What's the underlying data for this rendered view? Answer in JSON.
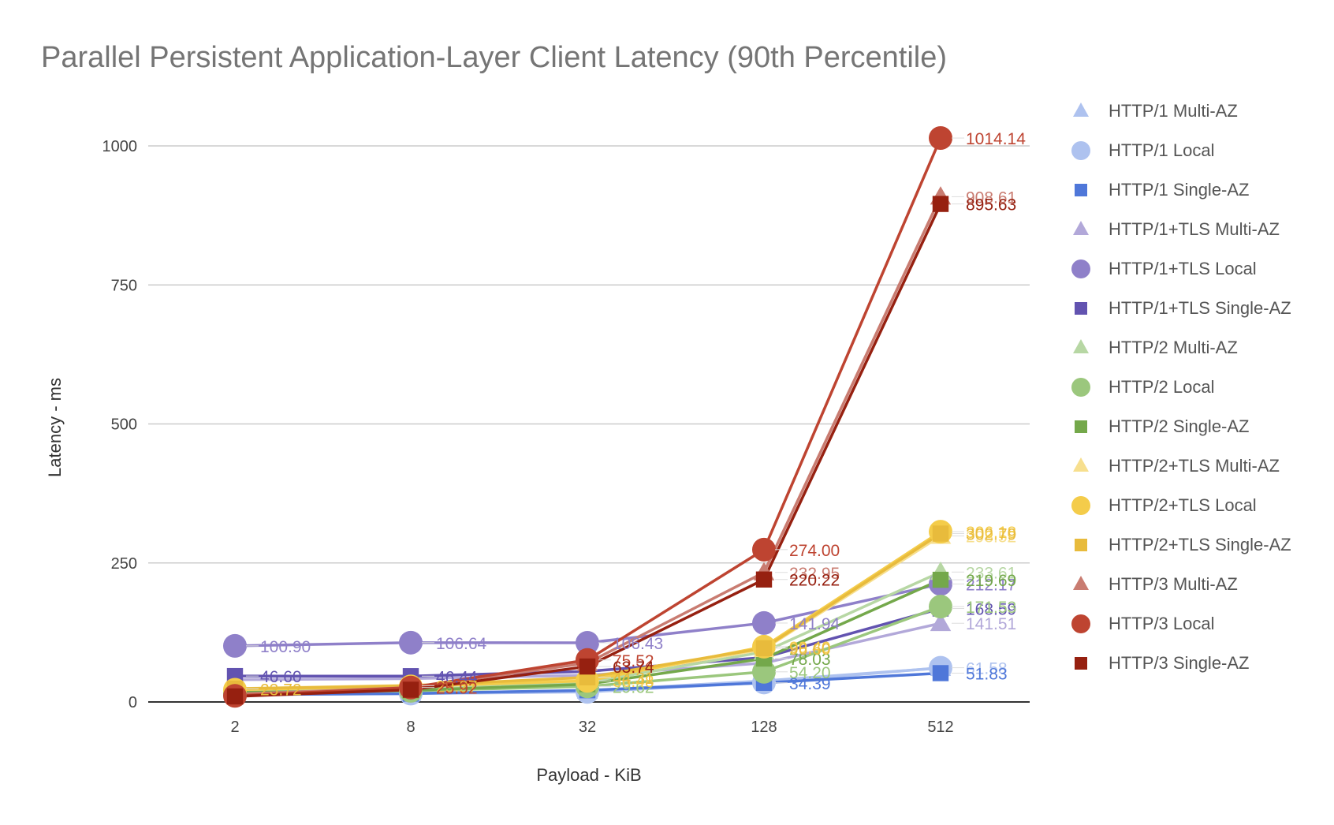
{
  "chart_data": {
    "type": "line",
    "title": "Parallel Persistent Application-Layer Client Latency (90th Percentile)",
    "xlabel": "Payload - KiB",
    "ylabel": "Latency - ms",
    "categories": [
      "2",
      "8",
      "32",
      "128",
      "512"
    ],
    "ylim": [
      0,
      1080
    ],
    "yticks": [
      "0",
      "250",
      "500",
      "750",
      "1000"
    ],
    "grid": true,
    "legend_position": "right",
    "series": [
      {
        "name": "HTTP/1 Multi-AZ",
        "marker": "triangle",
        "color": "#aec2ef",
        "values": [
          14,
          16,
          20,
          38,
          61
        ],
        "value_labels": [
          "",
          "",
          "",
          "",
          ""
        ]
      },
      {
        "name": "HTTP/1 Local",
        "marker": "circle",
        "color": "#aec2ef",
        "values": [
          13,
          15,
          18,
          35,
          61.58
        ],
        "value_labels": [
          "",
          "",
          "",
          "",
          "61.58"
        ]
      },
      {
        "name": "HTTP/1 Single-AZ",
        "marker": "square",
        "color": "#4f77d9",
        "values": [
          13,
          15,
          21,
          34.39,
          51.83
        ],
        "value_labels": [
          "",
          "",
          "",
          "34.39",
          "51.83"
        ]
      },
      {
        "name": "HTTP/1+TLS Multi-AZ",
        "marker": "triangle",
        "color": "#b2a8d9",
        "values": [
          40,
          42,
          48,
          70,
          141.51
        ],
        "value_labels": [
          "",
          "",
          "",
          "",
          "141.51"
        ]
      },
      {
        "name": "HTTP/1+TLS Local",
        "marker": "circle",
        "color": "#8f80c9",
        "values": [
          100.9,
          106.64,
          106.43,
          141.94,
          212.17
        ],
        "value_labels": [
          "100.90",
          "106.64",
          "106.43",
          "141.94",
          "212.17"
        ]
      },
      {
        "name": "HTTP/1+TLS Single-AZ",
        "marker": "square",
        "color": "#6253b0",
        "values": [
          46.6,
          46.44,
          55,
          80,
          168
        ],
        "value_labels": [
          "46.60",
          "46.44",
          "",
          "",
          "168.59"
        ]
      },
      {
        "name": "HTTP/2 Multi-AZ",
        "marker": "triangle",
        "color": "#b7d7a4",
        "values": [
          18,
          22,
          35,
          90,
          233.61
        ],
        "value_labels": [
          "",
          "",
          "",
          "",
          "233.61"
        ]
      },
      {
        "name": "HTTP/2 Local",
        "marker": "circle",
        "color": "#9bc77d",
        "values": [
          16,
          20,
          28,
          54.2,
          171.53
        ],
        "value_labels": [
          "",
          "",
          "29.62",
          "54.20",
          "171.53"
        ]
      },
      {
        "name": "HTTP/2 Single-AZ",
        "marker": "square",
        "color": "#74a84b",
        "values": [
          17,
          21,
          32,
          78.03,
          219.69
        ],
        "value_labels": [
          "",
          "",
          "",
          "78.03",
          "219.69"
        ]
      },
      {
        "name": "HTTP/2+TLS Multi-AZ",
        "marker": "triangle",
        "color": "#f7df8e",
        "values": [
          24,
          30,
          40,
          95,
          298.52
        ],
        "value_labels": [
          "",
          "",
          "",
          "",
          "298.52"
        ]
      },
      {
        "name": "HTTP/2+TLS Local",
        "marker": "circle",
        "color": "#f4cc4a",
        "values": [
          22,
          28,
          38,
          99.4,
          306.18
        ],
        "value_labels": [
          "",
          "",
          "36.48",
          "99.40",
          "306.18"
        ]
      },
      {
        "name": "HTTP/2+TLS Single-AZ",
        "marker": "square",
        "color": "#e8bb3c",
        "values": [
          23.72,
          29.27,
          44.31,
          96.6,
          302.79
        ],
        "value_labels": [
          "23.72",
          "29.27",
          "44.31",
          "96.60",
          "302.79"
        ]
      },
      {
        "name": "HTTP/3 Multi-AZ",
        "marker": "triangle",
        "color": "#c97c71",
        "values": [
          14,
          26,
          70,
          232.95,
          908.61
        ],
        "value_labels": [
          "",
          "",
          "",
          "232.95",
          "908.61"
        ]
      },
      {
        "name": "HTTP/3 Local",
        "marker": "circle",
        "color": "#be4431",
        "values": [
          11,
          25.92,
          75.52,
          274.0,
          1014.14
        ],
        "value_labels": [
          "",
          "25.92",
          "75.52",
          "274.00",
          "1014.14"
        ]
      },
      {
        "name": "HTTP/3 Single-AZ",
        "marker": "square",
        "color": "#962010",
        "values": [
          10,
          22,
          63.74,
          220.22,
          895.63
        ],
        "value_labels": [
          "",
          "",
          "63.74",
          "220.22",
          "895.63"
        ]
      }
    ]
  }
}
